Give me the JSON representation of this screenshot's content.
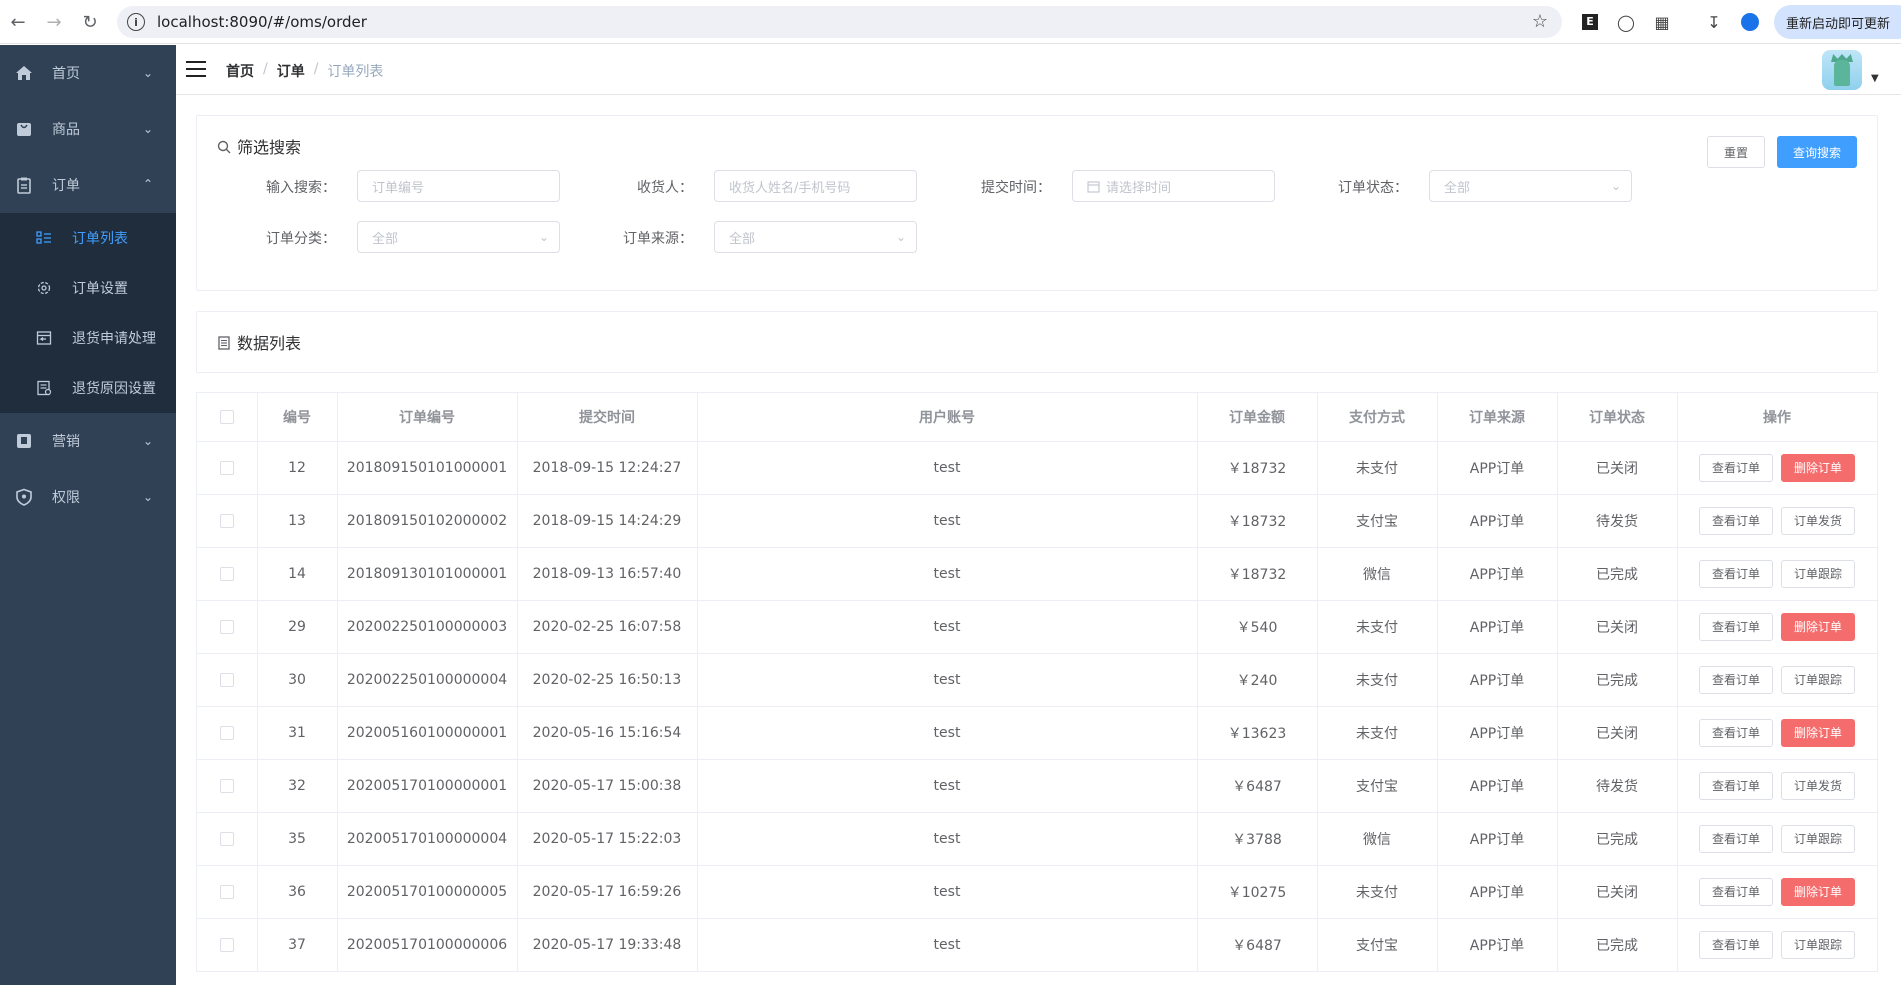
{
  "browser": {
    "url": "localhost:8090/#/oms/order",
    "update_label": "重新启动即可更新"
  },
  "sidebar": {
    "items": [
      {
        "label": "首页",
        "icon": "home-icon"
      },
      {
        "label": "商品",
        "icon": "bag-icon"
      },
      {
        "label": "订单",
        "icon": "clipboard-icon"
      },
      {
        "label": "营销",
        "icon": "badge-icon"
      },
      {
        "label": "权限",
        "icon": "shield-icon"
      }
    ],
    "order_sub": [
      {
        "label": "订单列表",
        "icon": "list-icon",
        "active": true
      },
      {
        "label": "订单设置",
        "icon": "gear-icon"
      },
      {
        "label": "退货申请处理",
        "icon": "return-icon"
      },
      {
        "label": "退货原因设置",
        "icon": "doc-icon"
      }
    ]
  },
  "breadcrumb": [
    "首页",
    "订单",
    "订单列表"
  ],
  "filter": {
    "title": "筛选搜索",
    "reset_label": "重置",
    "search_label": "查询搜索",
    "fields": {
      "keyword_label": "输入搜索：",
      "keyword_placeholder": "订单编号",
      "receiver_label": "收货人：",
      "receiver_placeholder": "收货人姓名/手机号码",
      "time_label": "提交时间：",
      "time_placeholder": "请选择时间",
      "status_label": "订单状态：",
      "status_value": "全部",
      "type_label": "订单分类：",
      "type_value": "全部",
      "source_label": "订单来源：",
      "source_value": "全部"
    }
  },
  "list": {
    "title": "数据列表",
    "columns": [
      "编号",
      "订单编号",
      "提交时间",
      "用户账号",
      "订单金额",
      "支付方式",
      "订单来源",
      "订单状态",
      "操作"
    ],
    "view_label": "查看订单",
    "rows": [
      {
        "id": "12",
        "sn": "201809150101000001",
        "time": "2018-09-15 12:24:27",
        "user": "test",
        "amount": "￥18732",
        "pay": "未支付",
        "source": "APP订单",
        "status": "已关闭",
        "action": "删除订单",
        "danger": true
      },
      {
        "id": "13",
        "sn": "201809150102000002",
        "time": "2018-09-15 14:24:29",
        "user": "test",
        "amount": "￥18732",
        "pay": "支付宝",
        "source": "APP订单",
        "status": "待发货",
        "action": "订单发货",
        "danger": false
      },
      {
        "id": "14",
        "sn": "201809130101000001",
        "time": "2018-09-13 16:57:40",
        "user": "test",
        "amount": "￥18732",
        "pay": "微信",
        "source": "APP订单",
        "status": "已完成",
        "action": "订单跟踪",
        "danger": false
      },
      {
        "id": "29",
        "sn": "202002250100000003",
        "time": "2020-02-25 16:07:58",
        "user": "test",
        "amount": "￥540",
        "pay": "未支付",
        "source": "APP订单",
        "status": "已关闭",
        "action": "删除订单",
        "danger": true
      },
      {
        "id": "30",
        "sn": "202002250100000004",
        "time": "2020-02-25 16:50:13",
        "user": "test",
        "amount": "￥240",
        "pay": "未支付",
        "source": "APP订单",
        "status": "已完成",
        "action": "订单跟踪",
        "danger": false
      },
      {
        "id": "31",
        "sn": "202005160100000001",
        "time": "2020-05-16 15:16:54",
        "user": "test",
        "amount": "￥13623",
        "pay": "未支付",
        "source": "APP订单",
        "status": "已关闭",
        "action": "删除订单",
        "danger": true
      },
      {
        "id": "32",
        "sn": "202005170100000001",
        "time": "2020-05-17 15:00:38",
        "user": "test",
        "amount": "￥6487",
        "pay": "支付宝",
        "source": "APP订单",
        "status": "待发货",
        "action": "订单发货",
        "danger": false
      },
      {
        "id": "35",
        "sn": "202005170100000004",
        "time": "2020-05-17 15:22:03",
        "user": "test",
        "amount": "￥3788",
        "pay": "微信",
        "source": "APP订单",
        "status": "已完成",
        "action": "订单跟踪",
        "danger": false
      },
      {
        "id": "36",
        "sn": "202005170100000005",
        "time": "2020-05-17 16:59:26",
        "user": "test",
        "amount": "￥10275",
        "pay": "未支付",
        "source": "APP订单",
        "status": "已关闭",
        "action": "删除订单",
        "danger": true
      },
      {
        "id": "37",
        "sn": "202005170100000006",
        "time": "2020-05-17 19:33:48",
        "user": "test",
        "amount": "￥6487",
        "pay": "支付宝",
        "source": "APP订单",
        "status": "已完成",
        "action": "订单跟踪",
        "danger": false
      }
    ]
  },
  "colors": {
    "sidebar_bg": "#304156",
    "submenu_bg": "#1f2d3d",
    "primary": "#409eff",
    "danger": "#f56c6c"
  }
}
